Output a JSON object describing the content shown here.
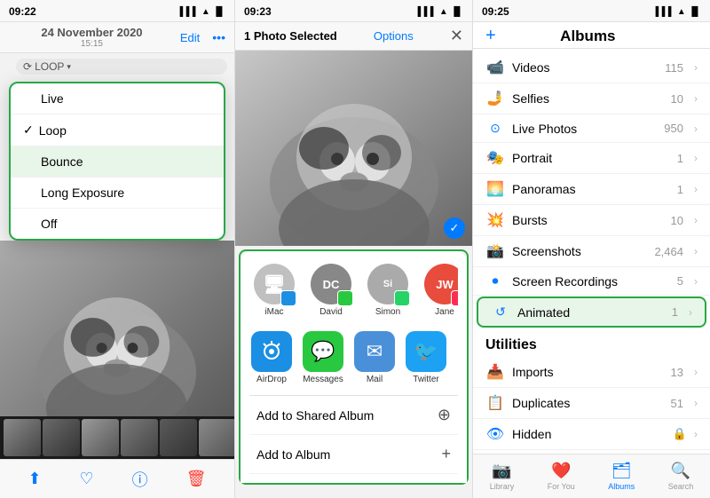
{
  "panel1": {
    "time": "09:22",
    "date": "24 November 2020",
    "date_sub": "15:15",
    "edit_label": "Edit",
    "loop_label": "LOOP",
    "dropdown": {
      "items": [
        {
          "label": "Live",
          "checked": false,
          "highlighted": false
        },
        {
          "label": "Loop",
          "checked": true,
          "highlighted": false
        },
        {
          "label": "Bounce",
          "checked": false,
          "highlighted": true
        },
        {
          "label": "Long Exposure",
          "checked": false,
          "highlighted": false
        },
        {
          "label": "Off",
          "checked": false,
          "highlighted": false
        }
      ]
    }
  },
  "panel2": {
    "time": "09:23",
    "selected_label": "1 Photo Selected",
    "options_label": "Options",
    "share_contacts": [
      {
        "name": "iMac",
        "initials": "🖥",
        "type": "imac"
      },
      {
        "name": "David",
        "initials": "DC",
        "type": "dc"
      },
      {
        "name": "Simon",
        "initials": "Si",
        "type": "simon"
      },
      {
        "name": "Jane",
        "initials": "JW",
        "type": "jw"
      }
    ],
    "share_apps": [
      {
        "name": "AirDrop",
        "type": "airdrop"
      },
      {
        "name": "Messages",
        "type": "messages"
      },
      {
        "name": "Mail",
        "type": "mail"
      },
      {
        "name": "Twitter",
        "type": "twitter"
      }
    ],
    "actions": [
      {
        "label": "Add to Shared Album"
      },
      {
        "label": "Add to Album"
      }
    ]
  },
  "panel3": {
    "time": "09:25",
    "title": "Albums",
    "add_button": "+",
    "albums_section": {
      "items": [
        {
          "label": "Videos",
          "count": "115",
          "icon": "📹"
        },
        {
          "label": "Selfies",
          "count": "10",
          "icon": "🤳"
        },
        {
          "label": "Live Photos",
          "count": "950",
          "icon": "🔵"
        },
        {
          "label": "Portrait",
          "count": "1",
          "icon": "🎭"
        },
        {
          "label": "Panoramas",
          "count": "1",
          "icon": "🌅"
        },
        {
          "label": "Bursts",
          "count": "10",
          "icon": "💥"
        },
        {
          "label": "Screenshots",
          "count": "2,464",
          "icon": "📸"
        },
        {
          "label": "Screen Recordings",
          "count": "5",
          "icon": "⏺",
          "highlighted": false
        },
        {
          "label": "Animated",
          "count": "1",
          "icon": "🔄",
          "highlighted": true
        }
      ]
    },
    "utilities_section": {
      "label": "Utilities",
      "items": [
        {
          "label": "Imports",
          "count": "13",
          "icon": "📥"
        },
        {
          "label": "Duplicates",
          "count": "51",
          "icon": "📋"
        },
        {
          "label": "Hidden",
          "count": "",
          "icon": "👁",
          "lock": true
        }
      ]
    },
    "bottom_tabs": [
      {
        "label": "Library",
        "icon": "📷",
        "active": false
      },
      {
        "label": "For You",
        "icon": "❤️",
        "active": false
      },
      {
        "label": "Albums",
        "icon": "🗂",
        "active": true
      },
      {
        "label": "Search",
        "icon": "🔍",
        "active": false
      }
    ]
  }
}
